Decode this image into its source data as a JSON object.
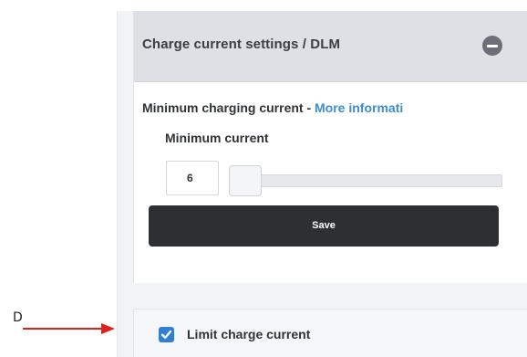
{
  "panel": {
    "title": "Charge current settings / DLM",
    "collapse_icon": "minus-circle-icon"
  },
  "minimum_charging": {
    "label": "Minimum charging current - ",
    "link_text": "More informati",
    "field_label": "Minimum current",
    "value": "6",
    "slider_fraction": 0.0
  },
  "save_button": {
    "label": "Save"
  },
  "limit_charge": {
    "label": "Limit charge current",
    "checked": true
  },
  "annotation": {
    "letter": "D",
    "arrow_color": "#e0201c"
  },
  "colors": {
    "header_bg": "#dde1e6",
    "link": "#3b8ed0",
    "save_bg": "#2d2f31",
    "checkbox": "#2f7fd3"
  }
}
